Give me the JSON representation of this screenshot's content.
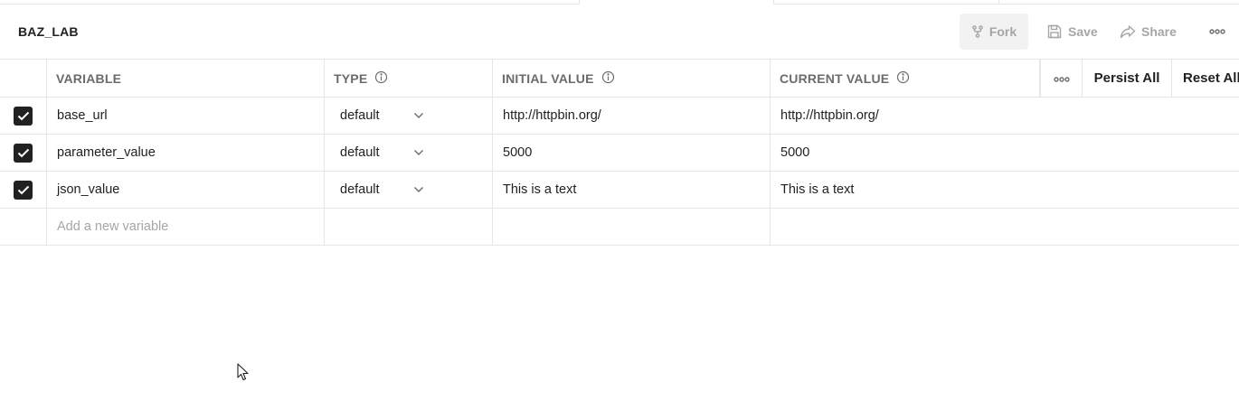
{
  "collection": {
    "title": "BAZ_LAB"
  },
  "toolbar": {
    "fork_label": "Fork",
    "save_label": "Save",
    "share_label": "Share"
  },
  "table": {
    "headers": {
      "variable": "VARIABLE",
      "type": "TYPE",
      "initial_value": "INITIAL VALUE",
      "current_value": "CURRENT VALUE",
      "persist_all": "Persist All",
      "reset_all": "Reset All"
    },
    "rows": [
      {
        "enabled": true,
        "variable": "base_url",
        "type": "default",
        "initial_value": "http://httpbin.org/",
        "current_value": "http://httpbin.org/"
      },
      {
        "enabled": true,
        "variable": "parameter_value",
        "type": "default",
        "initial_value": "5000",
        "current_value": "5000"
      },
      {
        "enabled": true,
        "variable": "json_value",
        "type": "default",
        "initial_value": "This is a text",
        "current_value": "This is a text"
      }
    ],
    "new_variable_placeholder": "Add a new variable"
  },
  "colors": {
    "text": "#212121",
    "muted": "#6b6b6b",
    "disabled": "#a6a6a6",
    "border": "#e6e6e6",
    "checkbox": "#212121"
  }
}
